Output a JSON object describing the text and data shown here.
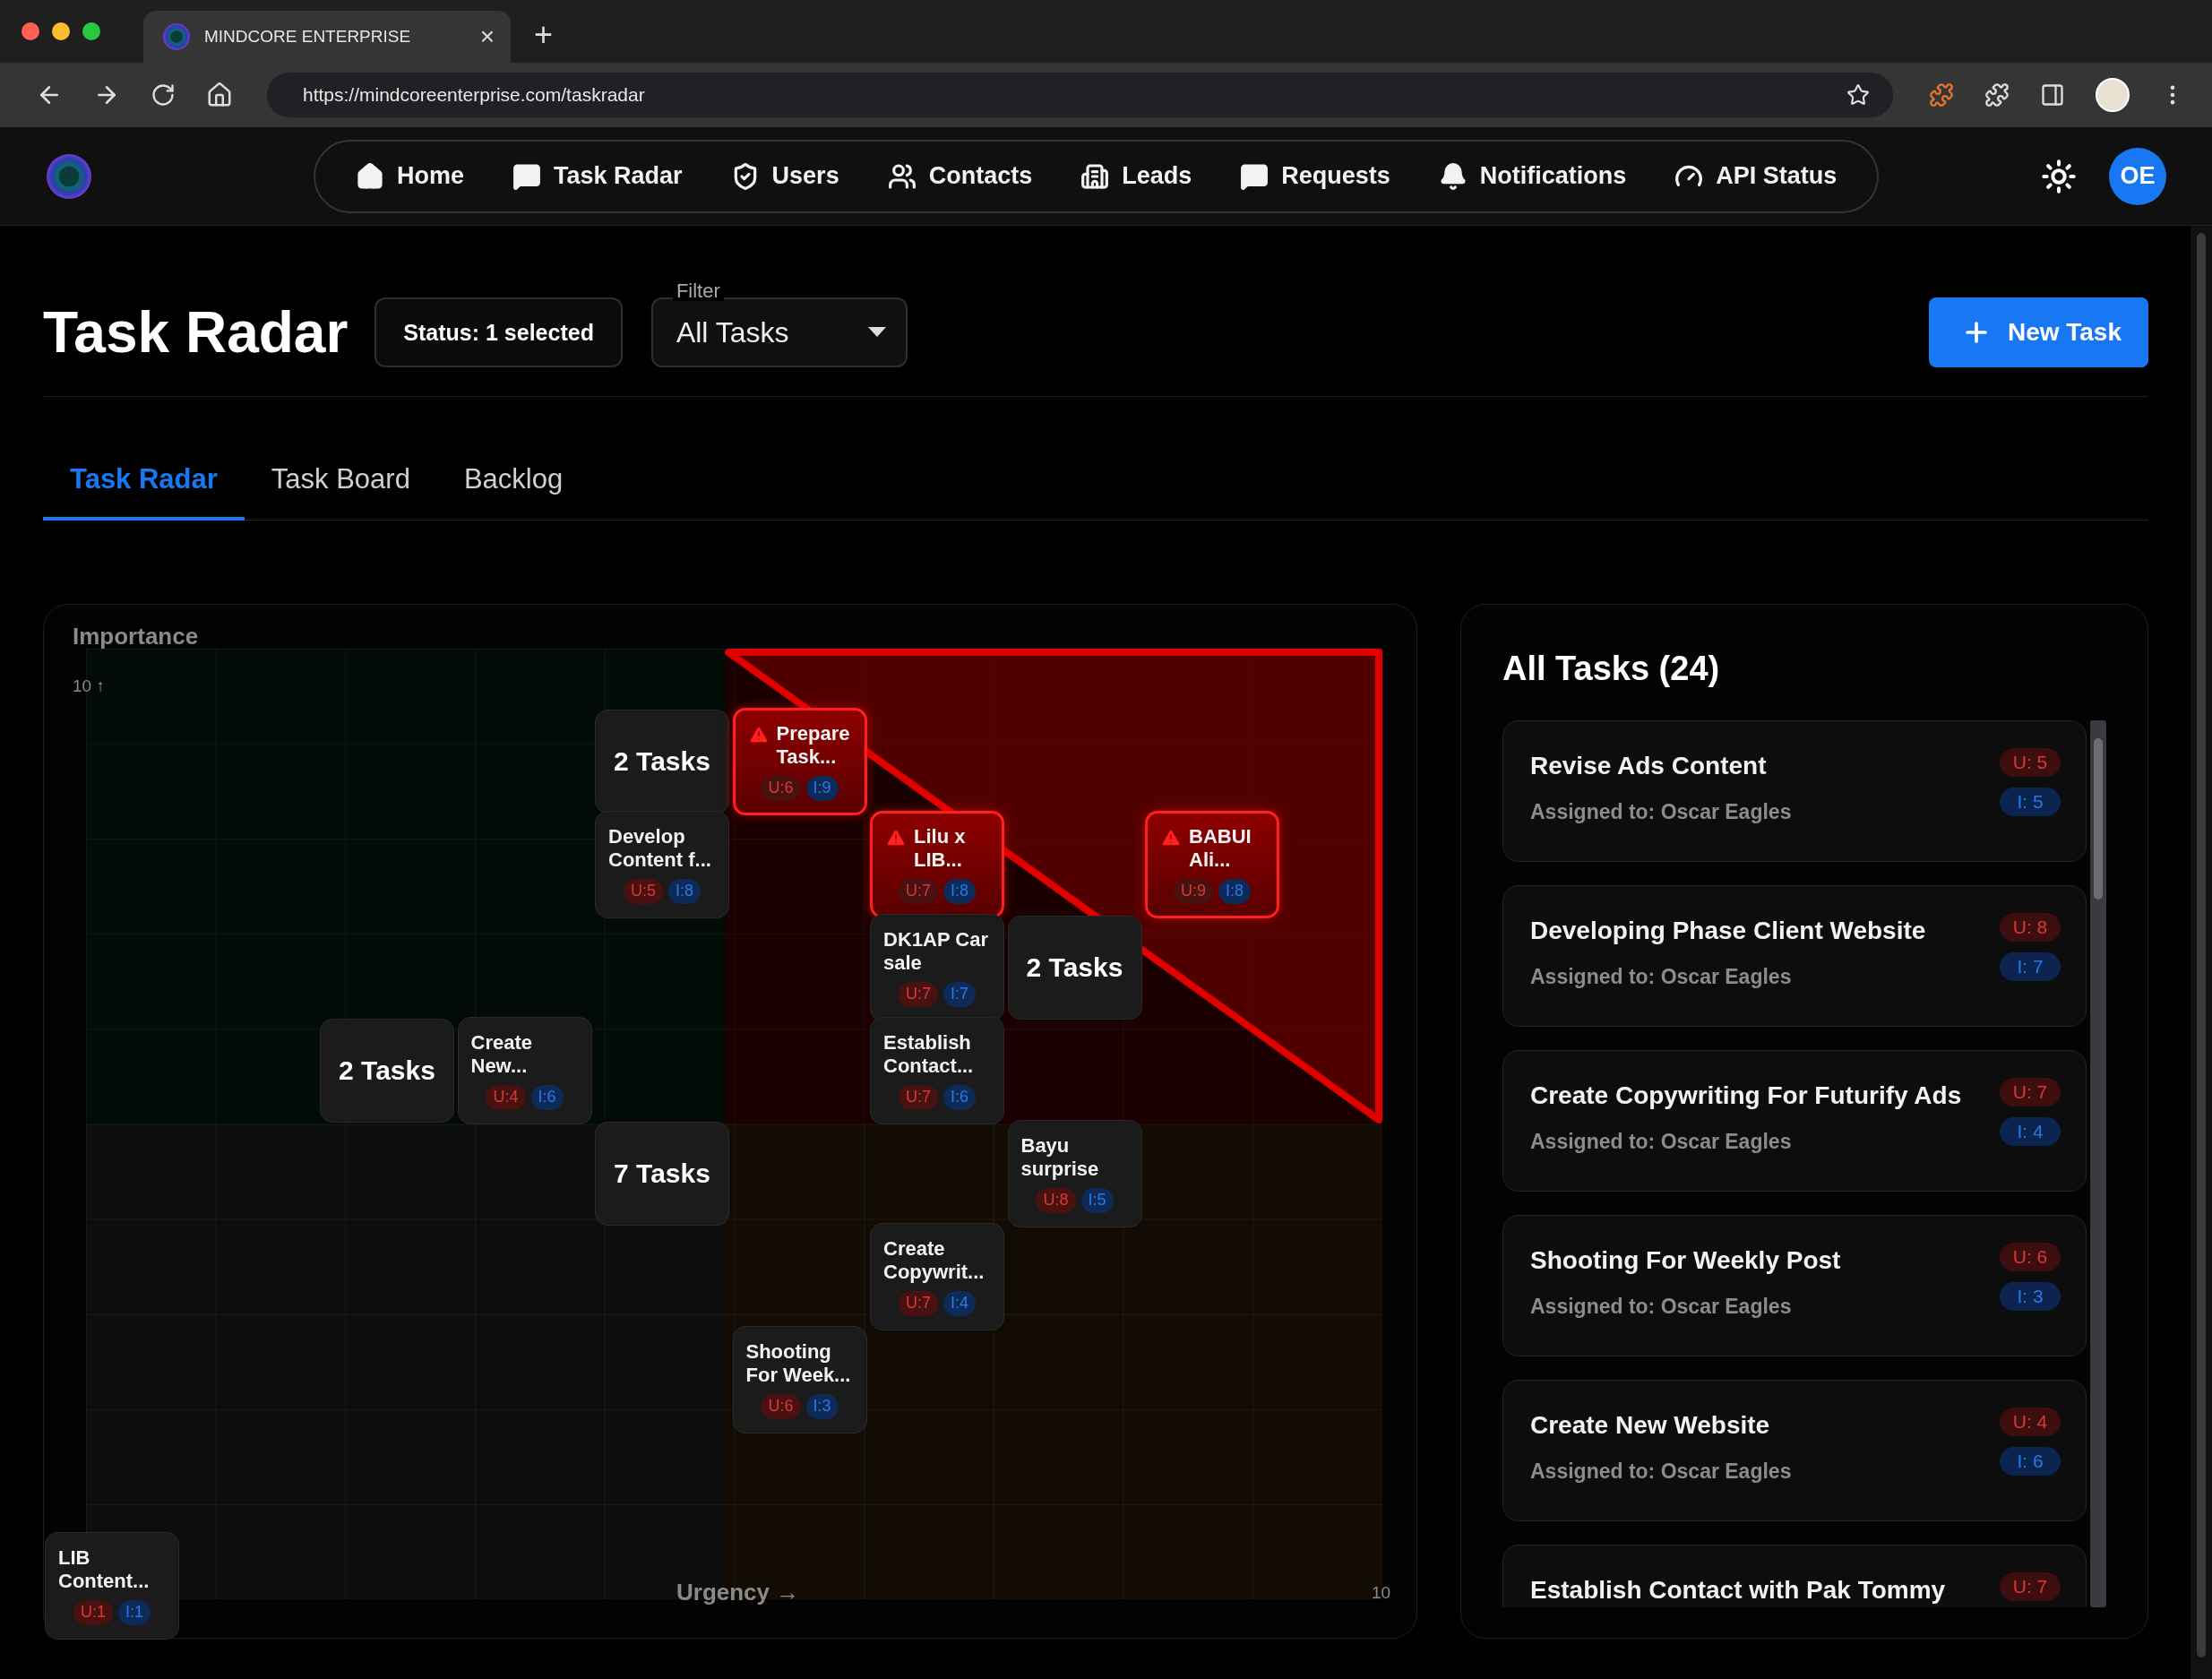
{
  "browser": {
    "tab_title": "MINDCORE ENTERPRISE",
    "tab_close": "×",
    "new_tab": "+",
    "url": "https://mindcoreenterprise.com/taskradar"
  },
  "nav": {
    "items": [
      {
        "label": "Home"
      },
      {
        "label": "Task Radar"
      },
      {
        "label": "Users"
      },
      {
        "label": "Contacts"
      },
      {
        "label": "Leads"
      },
      {
        "label": "Requests"
      },
      {
        "label": "Notifications"
      },
      {
        "label": "API Status"
      }
    ],
    "avatar": "OE"
  },
  "page": {
    "title": "Task Radar",
    "status_button": "Status: 1 selected",
    "filter": {
      "label": "Filter",
      "value": "All Tasks"
    },
    "new_task_button": "New Task"
  },
  "tabs": [
    {
      "label": "Task Radar",
      "selected": true
    },
    {
      "label": "Task Board",
      "selected": false
    },
    {
      "label": "Backlog",
      "selected": false
    }
  ],
  "radar": {
    "y_axis_label": "Importance",
    "y_max_label": "10 ↑",
    "x_axis_label": "Urgency →",
    "x_max_label": "10",
    "nodes": [
      {
        "kind": "group",
        "label": "2 Tasks"
      },
      {
        "kind": "task",
        "title": "Prepare Task...",
        "urgent": true,
        "urgency_badge": "U:6",
        "importance_badge": "I:9"
      },
      {
        "kind": "task",
        "title": "Develop Content f...",
        "urgent": false,
        "urgency_badge": "U:5",
        "importance_badge": "I:8"
      },
      {
        "kind": "task",
        "title": "Lilu x LIB...",
        "urgent": true,
        "urgency_badge": "U:7",
        "importance_badge": "I:8"
      },
      {
        "kind": "task",
        "title": "BABUI Ali...",
        "urgent": true,
        "urgency_badge": "U:9",
        "importance_badge": "I:8"
      },
      {
        "kind": "task",
        "title": "DK1AP Car sale",
        "urgent": false,
        "urgency_badge": "U:7",
        "importance_badge": "I:7"
      },
      {
        "kind": "group",
        "label": "2 Tasks"
      },
      {
        "kind": "group",
        "label": "2 Tasks"
      },
      {
        "kind": "task",
        "title": "Create New...",
        "urgent": false,
        "urgency_badge": "U:4",
        "importance_badge": "I:6"
      },
      {
        "kind": "task",
        "title": "Establish Contact...",
        "urgent": false,
        "urgency_badge": "U:7",
        "importance_badge": "I:6"
      },
      {
        "kind": "group",
        "label": "7 Tasks"
      },
      {
        "kind": "task",
        "title": "Bayu surprise",
        "urgent": false,
        "urgency_badge": "U:8",
        "importance_badge": "I:5"
      },
      {
        "kind": "task",
        "title": "Create Copywrit...",
        "urgent": false,
        "urgency_badge": "U:7",
        "importance_badge": "I:4"
      },
      {
        "kind": "task",
        "title": "Shooting For Week...",
        "urgent": false,
        "urgency_badge": "U:6",
        "importance_badge": "I:3"
      },
      {
        "kind": "task",
        "title": "LIB Content...",
        "urgent": false,
        "urgency_badge": "U:1",
        "importance_badge": "I:1"
      }
    ]
  },
  "task_list": {
    "title": "All Tasks (24)",
    "items": [
      {
        "title": "Revise Ads Content",
        "assignee": "Assigned to: Oscar Eagles",
        "urgency_badge": "U: 5",
        "importance_badge": "I: 5"
      },
      {
        "title": "Developing Phase Client Website",
        "assignee": "Assigned to: Oscar Eagles",
        "urgency_badge": "U: 8",
        "importance_badge": "I: 7"
      },
      {
        "title": "Create Copywriting For Futurify Ads",
        "assignee": "Assigned to: Oscar Eagles",
        "urgency_badge": "U: 7",
        "importance_badge": "I: 4"
      },
      {
        "title": "Shooting For Weekly Post",
        "assignee": "Assigned to: Oscar Eagles",
        "urgency_badge": "U: 6",
        "importance_badge": "I: 3"
      },
      {
        "title": "Create New Website",
        "assignee": "Assigned to: Oscar Eagles",
        "urgency_badge": "U: 4",
        "importance_badge": "I: 6"
      },
      {
        "title": "Establish Contact with Pak Tommy",
        "urgency_badge": "U: 7"
      }
    ]
  }
}
